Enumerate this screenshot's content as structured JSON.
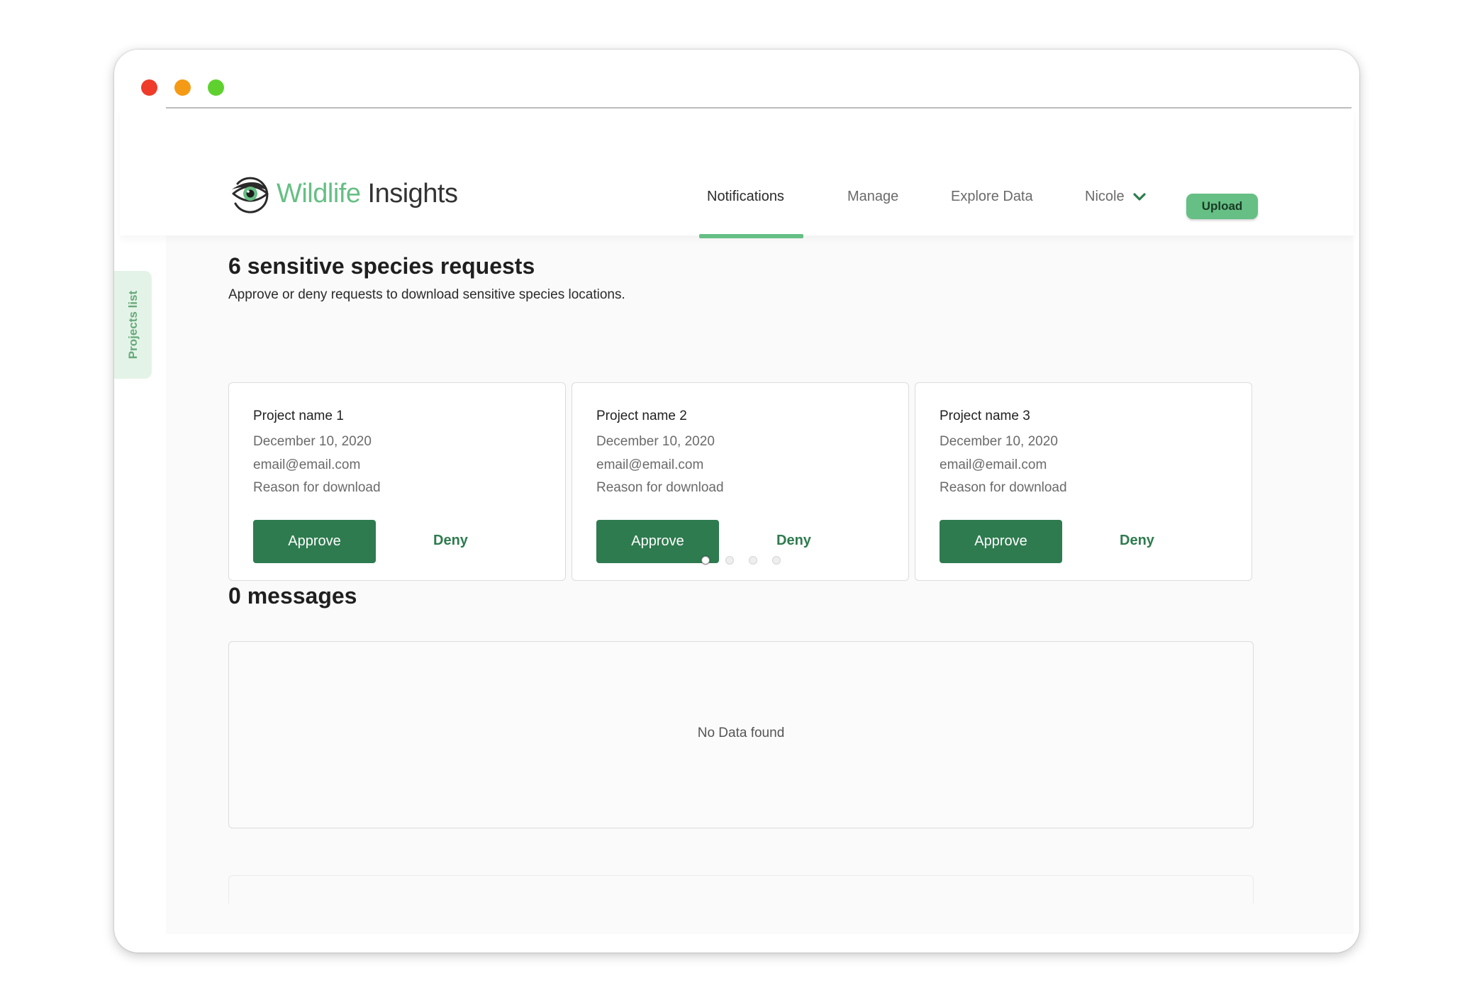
{
  "colors": {
    "brand_green": "#66bf84",
    "action_green": "#2e7b4f",
    "window_dot_red": "#ee3b2a",
    "window_dot_orange": "#f59a14",
    "window_dot_green": "#5fd12f"
  },
  "header": {
    "logo_icon": "eye-icon",
    "logo_word1": "Wildlife",
    "logo_word2": "Insights",
    "nav": {
      "notifications": "Notifications",
      "manage": "Manage",
      "explore": "Explore Data"
    },
    "user_name": "Nicole",
    "upload_label": "Upload"
  },
  "sidebar_tab": {
    "label": "Projects list"
  },
  "requests": {
    "title": "6 sensitive species requests",
    "subtitle": "Approve or deny requests to download sensitive species locations.",
    "cards": [
      {
        "project": "Project name 1",
        "date": "December 10, 2020",
        "email": "email@email.com",
        "reason": "Reason for download",
        "approve": "Approve",
        "deny": "Deny"
      },
      {
        "project": "Project name 2",
        "date": "December 10, 2020",
        "email": "email@email.com",
        "reason": "Reason for download",
        "approve": "Approve",
        "deny": "Deny"
      },
      {
        "project": "Project name 3",
        "date": "December 10, 2020",
        "email": "email@email.com",
        "reason": "Reason for download",
        "approve": "Approve",
        "deny": "Deny"
      }
    ],
    "pager": {
      "pages": 4,
      "active": 1
    }
  },
  "messages": {
    "title": "0 messages",
    "empty_text": "No Data found"
  }
}
